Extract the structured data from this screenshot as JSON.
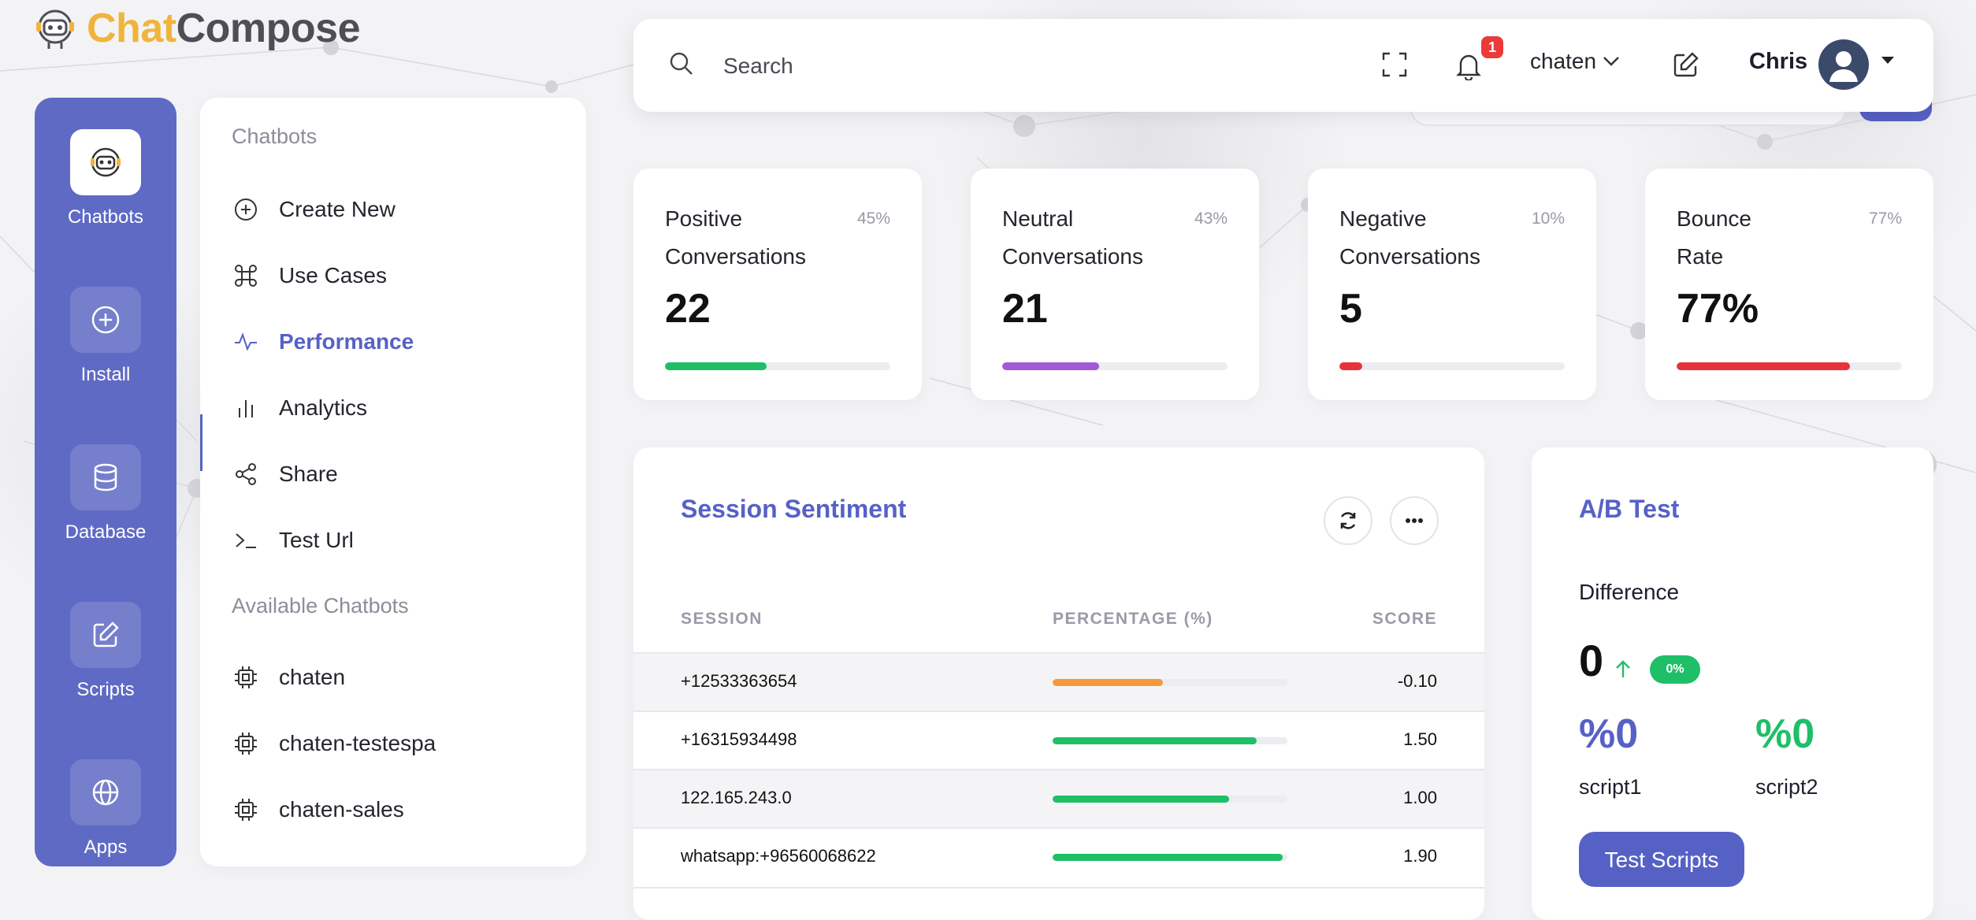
{
  "app": {
    "name_part1": "Chat",
    "name_part2": "Compose"
  },
  "rail": {
    "items": [
      {
        "label": "Chatbots",
        "icon": "robot-icon",
        "active": true
      },
      {
        "label": "Install",
        "icon": "plus-circle-icon"
      },
      {
        "label": "Database",
        "icon": "database-icon"
      },
      {
        "label": "Scripts",
        "icon": "edit-icon"
      },
      {
        "label": "Apps",
        "icon": "globe-icon"
      }
    ]
  },
  "menu": {
    "section_title": "Chatbots",
    "items": [
      {
        "label": "Create New",
        "icon": "plus-circle-icon"
      },
      {
        "label": "Use Cases",
        "icon": "command-icon"
      },
      {
        "label": "Performance",
        "icon": "activity-icon",
        "active": true
      },
      {
        "label": "Analytics",
        "icon": "bar-chart-icon"
      },
      {
        "label": "Share",
        "icon": "share-icon"
      },
      {
        "label": "Test Url",
        "icon": "terminal-icon"
      }
    ],
    "available_title": "Available Chatbots",
    "chatbots": [
      {
        "label": "chaten",
        "icon": "cpu-icon"
      },
      {
        "label": "chaten-testespa",
        "icon": "cpu-icon"
      },
      {
        "label": "chaten-sales",
        "icon": "cpu-icon"
      }
    ]
  },
  "topbar": {
    "search_placeholder": "Search",
    "notification_count": "1",
    "workspace": "chaten",
    "user_name": "Chris"
  },
  "stats": [
    {
      "title_line1": "Positive",
      "title_line2": "Conversations",
      "percent": "45%",
      "value": "22",
      "fill": 0.45,
      "color": "#1fbf67"
    },
    {
      "title_line1": "Neutral",
      "title_line2": "Conversations",
      "percent": "43%",
      "value": "21",
      "fill": 0.43,
      "color": "#a05ad8"
    },
    {
      "title_line1": "Negative",
      "title_line2": "Conversations",
      "percent": "10%",
      "value": "5",
      "fill": 0.1,
      "color": "#e8323a"
    },
    {
      "title_line1": "Bounce",
      "title_line2": "Rate",
      "percent": "77%",
      "value": "77%",
      "fill": 0.77,
      "color": "#e8323a"
    }
  ],
  "sentiment": {
    "title": "Session Sentiment",
    "columns": {
      "session": "SESSION",
      "percentage": "PERCENTAGE (%)",
      "score": "SCORE"
    },
    "rows": [
      {
        "session": "+12533363654",
        "fill": 0.47,
        "color": "#f59a3c",
        "score": "-0.10"
      },
      {
        "session": "+16315934498",
        "fill": 0.87,
        "color": "#1fbf67",
        "score": "1.50"
      },
      {
        "session": "122.165.243.0",
        "fill": 0.75,
        "color": "#1fbf67",
        "score": "1.00"
      },
      {
        "session": "whatsapp:+96560068622",
        "fill": 0.98,
        "color": "#1fbf67",
        "score": "1.90"
      }
    ]
  },
  "ab_test": {
    "title": "A/B Test",
    "difference_label": "Difference",
    "difference_value": "0",
    "difference_pct": "0%",
    "script1_value": "%0",
    "script1_label": "script1",
    "script2_value": "%0",
    "script2_label": "script2",
    "button_label": "Test Scripts"
  },
  "colors": {
    "accent": "#5661c6",
    "rail": "#5f6ac4",
    "positive": "#1fbf67",
    "negative": "#e8323a",
    "logo_yellow": "#f0b43d"
  }
}
